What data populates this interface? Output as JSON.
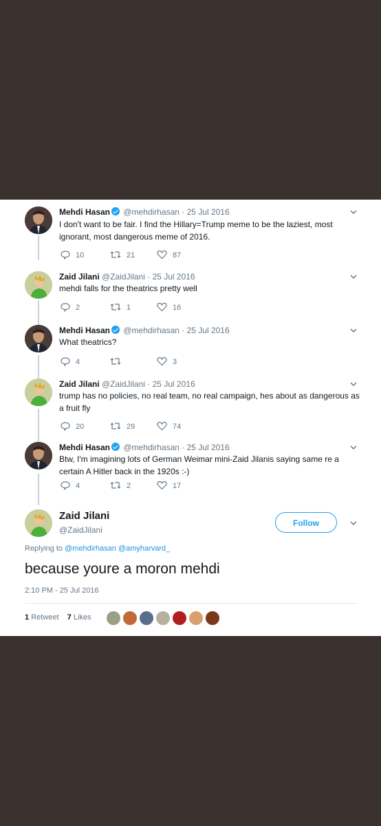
{
  "thread": [
    {
      "name": "Mehdi Hasan",
      "verified": true,
      "handle": "@mehdirhasan",
      "date": "· 25 Jul 2016",
      "text": "I don't want to be fair. I find the Hillary=Trump meme to be the laziest, most ignorant, most dangerous meme of 2016.",
      "replies": "10",
      "retweets": "21",
      "likes": "87",
      "avatar": "mehdi"
    },
    {
      "name": "Zaid Jilani",
      "verified": false,
      "handle": "@ZaidJilani",
      "date": "· 25 Jul 2016",
      "text": "mehdi falls for the theatrics pretty well",
      "replies": "2",
      "retweets": "1",
      "likes": "16",
      "avatar": "zaid"
    },
    {
      "name": "Mehdi Hasan",
      "verified": true,
      "handle": "@mehdirhasan",
      "date": "· 25 Jul 2016",
      "text": "What theatrics?",
      "replies": "4",
      "retweets": "",
      "likes": "3",
      "avatar": "mehdi"
    },
    {
      "name": "Zaid Jilani",
      "verified": false,
      "handle": "@ZaidJilani",
      "date": "· 25 Jul 2016",
      "text": "trump has no policies, no real team, no real campaign, hes about as dangerous as a fruit fly",
      "replies": "20",
      "retweets": "29",
      "likes": "74",
      "avatar": "zaid"
    },
    {
      "name": "Mehdi Hasan",
      "verified": true,
      "handle": "@mehdirhasan",
      "date": "· 25 Jul 2016",
      "text": "Btw, I'm imagining lots of German Weimar mini-Zaid Jilanis saying same re a certain A Hitler back in the 1920s :-)",
      "replies": "4",
      "retweets": "2",
      "likes": "17",
      "avatar": "mehdi"
    }
  ],
  "main_tweet": {
    "name": "Zaid Jilani",
    "handle": "@ZaidJilani",
    "follow_label": "Follow",
    "replying_prefix": "Replying to",
    "replying_to": "@mehdirhasan @amyharvard_",
    "text": "because youre a moron mehdi",
    "timestamp": "2:10 PM - 25 Jul 2016",
    "retweet_count": "1",
    "retweet_label": "Retweet",
    "like_count": "7",
    "like_label": "Likes"
  },
  "icons": {
    "reply": "reply-icon",
    "retweet": "retweet-icon",
    "like": "heart-icon",
    "caret": "chevron-down-icon",
    "verified": "verified-badge-icon"
  },
  "colors": {
    "background": "#3a302d",
    "accent": "#1da1f2",
    "muted": "#657786",
    "text": "#14171a"
  }
}
